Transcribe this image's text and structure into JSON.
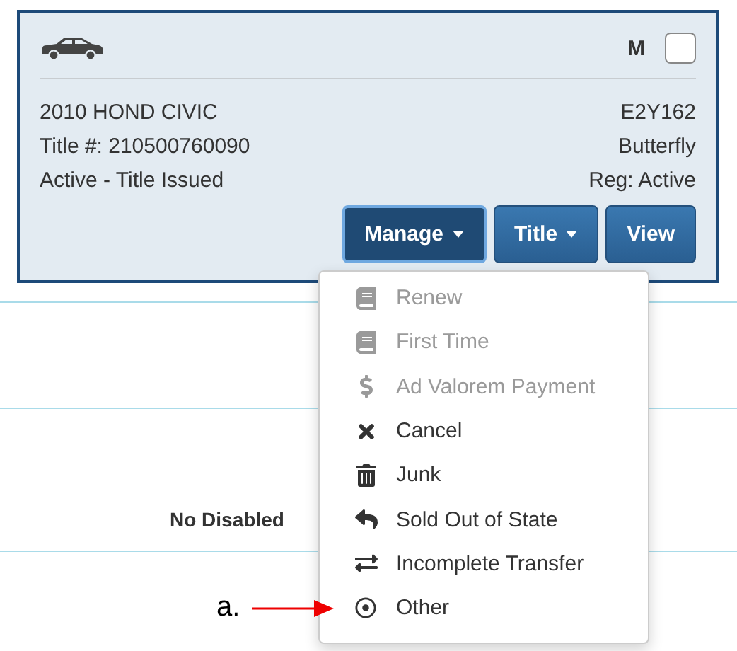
{
  "vehicle": {
    "badge": "M",
    "checked": false,
    "description": "2010 HOND CIVIC",
    "title_number": "Title #: 210500760090",
    "status": "Active - Title Issued",
    "plate": "E2Y162",
    "plate_type": "Butterfly",
    "registration": "Reg: Active"
  },
  "buttons": [
    {
      "label": "Manage",
      "dropdown": true,
      "selected": true
    },
    {
      "label": "Title",
      "dropdown": true,
      "selected": false
    },
    {
      "label": "View",
      "dropdown": false,
      "selected": false
    }
  ],
  "menu": [
    {
      "kind": "book",
      "label": "Renew",
      "disabled": true
    },
    {
      "kind": "book",
      "label": "First Time",
      "disabled": true
    },
    {
      "kind": "dollar",
      "label": "Ad Valorem Payment",
      "disabled": true
    },
    {
      "kind": "cancel",
      "label": "Cancel",
      "disabled": false
    },
    {
      "kind": "trash",
      "label": "Junk",
      "disabled": false
    },
    {
      "kind": "reply",
      "label": "Sold Out of State",
      "disabled": false
    },
    {
      "kind": "exchange",
      "label": "Incomplete Transfer",
      "disabled": false
    },
    {
      "kind": "other",
      "label": "Other",
      "disabled": false
    }
  ],
  "background_text": "No Disabled",
  "annotation": "a."
}
